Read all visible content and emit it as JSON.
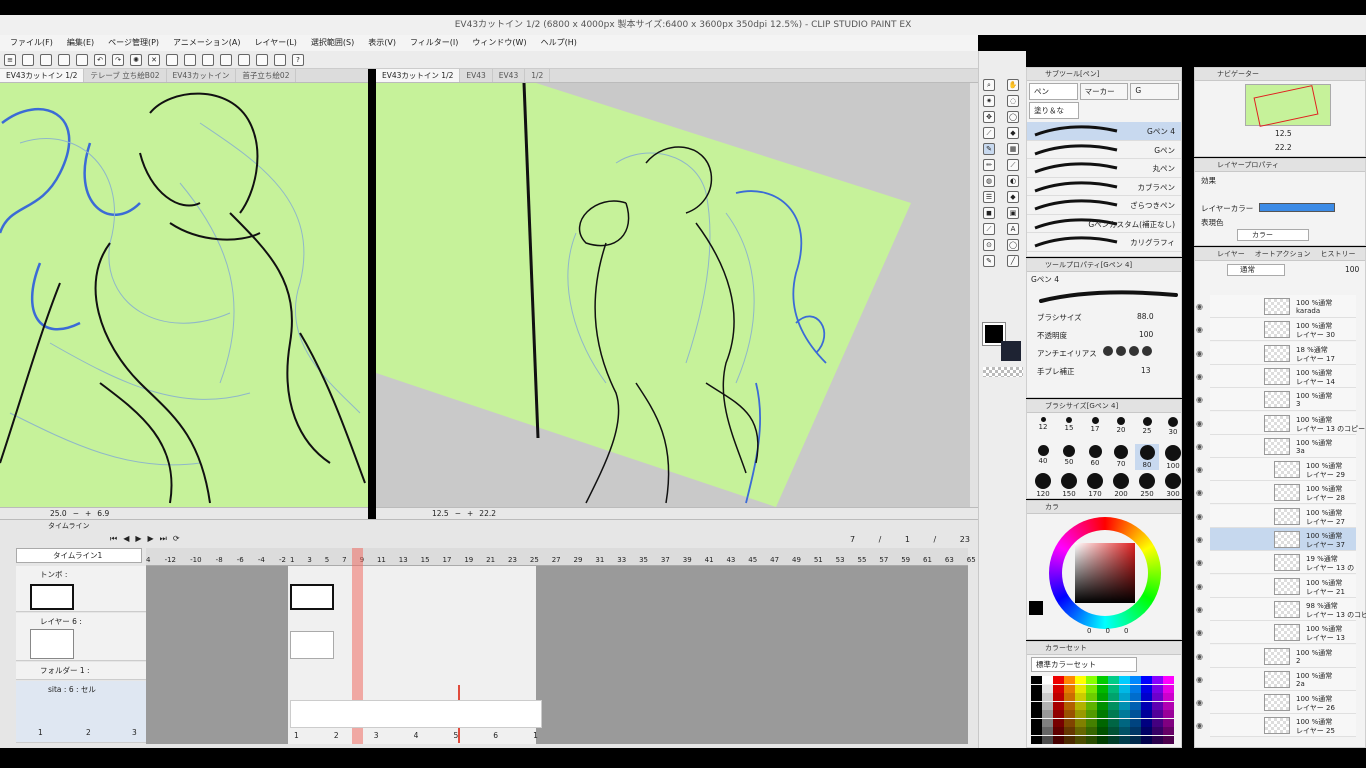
{
  "window": {
    "title": "EV43カットイン 1/2 (6800 x 4000px 製本サイズ:6400 x 3600px 350dpi 12.5%) - CLIP STUDIO PAINT EX"
  },
  "menu": [
    "ファイル(F)",
    "編集(E)",
    "ページ管理(P)",
    "アニメーション(A)",
    "レイヤー(L)",
    "選択範囲(S)",
    "表示(V)",
    "フィルター(I)",
    "ウィンドウ(W)",
    "ヘルプ(H)"
  ],
  "left_tabs": [
    "EV43カットイン 1/2",
    "テレーブ 立ち絵B02",
    "EV43カットイン",
    "首子立ち絵02"
  ],
  "right_tabs": [
    "EV43カットイン 1/2",
    "EV43",
    "EV43",
    "1/2"
  ],
  "left_status": {
    "zoom": "25.0",
    "angle": "6.9"
  },
  "right_status": {
    "zoom": "12.5",
    "angle": "22.2"
  },
  "subtool": {
    "header": "サブツール[ペン]",
    "tabs": [
      "ペン",
      "マーカー",
      "G"
    ],
    "group": "塗り＆な",
    "brushes": [
      "Gペン 4",
      "Gペン",
      "丸ペン",
      "カブラペン",
      "ざらつきペン",
      "Gペンカスタム(補正なし)",
      "カリグラフィ"
    ]
  },
  "tool_property": {
    "header": "ツールプロパティ[Gペン 4]",
    "name": "Gペン 4",
    "brush_size_label": "ブラシサイズ",
    "brush_size": "88.0",
    "opacity_label": "不透明度",
    "opacity": "100",
    "antialias_label": "アンチエイリアス",
    "stabilizer_label": "手ブレ補正",
    "stabilizer": "13"
  },
  "brush_size_panel": {
    "header": "ブラシサイズ[Gペン 4]",
    "sizes": [
      "12",
      "15",
      "17",
      "20",
      "25",
      "30",
      "40",
      "50",
      "60",
      "70",
      "80",
      "100",
      "120",
      "150",
      "170",
      "200",
      "250",
      "300"
    ],
    "selected": "80"
  },
  "color_wheel": {
    "header": "カラ",
    "rgb": [
      "0",
      "0",
      "0"
    ]
  },
  "color_set": {
    "header": "カラーセット",
    "name": "標準カラーセット"
  },
  "navigator": {
    "header": "ナビゲーター",
    "zoom": "12.5",
    "angle": "22.2"
  },
  "layer_property": {
    "header": "レイヤープロパティ",
    "effect_label": "効果",
    "layer_color_label": "レイヤーカラー",
    "expression_label": "表現色",
    "expression_value": "カラー"
  },
  "layer_panel": {
    "tabs": [
      "レイヤー",
      "オートアクション",
      "ヒストリー"
    ],
    "blend_mode": "通常",
    "opacity": "100",
    "layers": [
      {
        "line1": "100 %通常",
        "line2": "karada"
      },
      {
        "line1": "100 %通常",
        "line2": "レイヤー 30"
      },
      {
        "line1": "18 %通常",
        "line2": "レイヤー 17"
      },
      {
        "line1": "100 %通常",
        "line2": "レイヤー 14"
      },
      {
        "line1": "100 %通常",
        "line2": "3"
      },
      {
        "line1": "100 %通常",
        "line2": "レイヤー 13 のコピー 2"
      },
      {
        "line1": "100 %通常",
        "line2": "3a"
      },
      {
        "line1": "100 %通常",
        "line2": "レイヤー 29"
      },
      {
        "line1": "100 %通常",
        "line2": "レイヤー 28"
      },
      {
        "line1": "100 %通常",
        "line2": "レイヤー 27"
      },
      {
        "line1": "100 %通常",
        "line2": "レイヤー 37"
      },
      {
        "line1": "19 %通常",
        "line2": "レイヤー 13 の"
      },
      {
        "line1": "100 %通常",
        "line2": "レイヤー 21"
      },
      {
        "line1": "98 %通常",
        "line2": "レイヤー 13 のコピー"
      },
      {
        "line1": "100 %通常",
        "line2": "レイヤー 13"
      },
      {
        "line1": "100 %通常",
        "line2": "2"
      },
      {
        "line1": "100 %通常",
        "line2": "2a"
      },
      {
        "line1": "100 %通常",
        "line2": "レイヤー 26"
      },
      {
        "line1": "100 %通常",
        "line2": "レイヤー 25"
      }
    ]
  },
  "timeline": {
    "header": "タイムライン",
    "name": "タイムライン1",
    "counter": [
      "7",
      "/",
      "1",
      "/",
      "23"
    ],
    "ruler_neg": [
      "4",
      "-12",
      "-10",
      "-8",
      "-6",
      "-4",
      "-2"
    ],
    "ruler_pos": [
      "1",
      "3",
      "5",
      "7",
      "9",
      "11",
      "13",
      "15",
      "17",
      "19",
      "21",
      "23",
      "25",
      "27",
      "29",
      "31",
      "33",
      "35",
      "37",
      "39",
      "41",
      "43",
      "45",
      "47",
      "49",
      "51",
      "53",
      "55",
      "57",
      "59",
      "61",
      "63",
      "65"
    ],
    "tracks": [
      "トンボ :",
      "レイヤー 6 :",
      "フォルダー 1 :",
      "sita : 6 : セル"
    ],
    "cell_numbers": [
      "1",
      "2",
      "3",
      "4",
      "5",
      "6",
      "1"
    ],
    "left_cell_numbers": [
      "1",
      "2",
      "3"
    ]
  }
}
